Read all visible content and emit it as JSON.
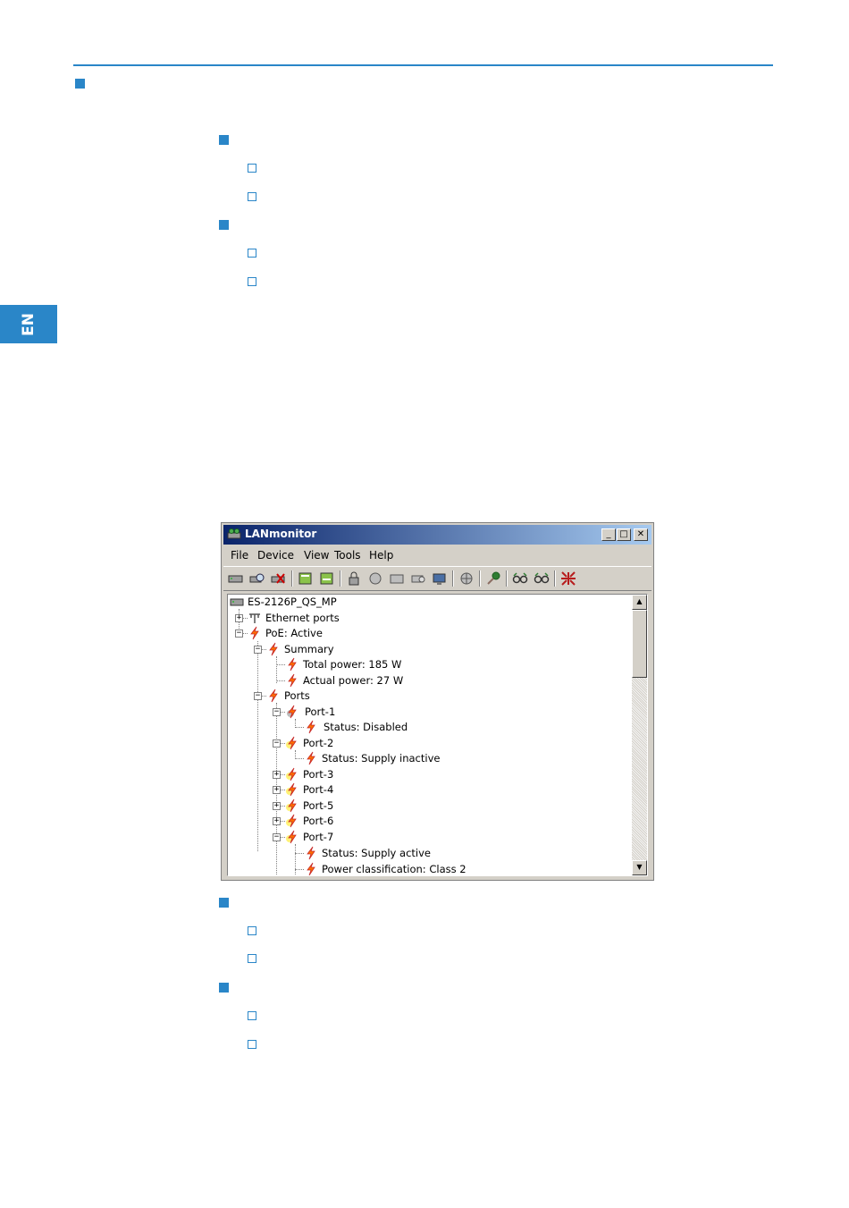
{
  "page": {
    "language_tab": "EN"
  },
  "window": {
    "title": "LANmonitor",
    "controls": {
      "minimize": "_",
      "maximize": "□",
      "close": "✕"
    },
    "menu": [
      "File",
      "Device",
      "View",
      "Tools",
      "Help"
    ],
    "toolbar_icons": [
      "device-icon",
      "search-device-icon",
      "delete-device-icon",
      "refresh-icon",
      "refresh-all-icon",
      "lock-icon",
      "hand-icon",
      "device-settings-icon",
      "trace-icon",
      "monitor-icon",
      "globe-icon",
      "key-icon",
      "glasses-icon",
      "glasses-all-icon",
      "collapse-icon"
    ]
  },
  "tree": {
    "root": "ES-2126P_QS_MP",
    "ethernet_ports": "Ethernet ports",
    "poe": "PoE: Active",
    "summary": "Summary",
    "total_power": "Total power: 185 W",
    "actual_power": "Actual power: 27 W",
    "ports": "Ports",
    "port1": "Port-1",
    "port1_status": "Status: Disabled",
    "port2": "Port-2",
    "port2_status": "Status: Supply inactive",
    "port3": "Port-3",
    "port4": "Port-4",
    "port5": "Port-5",
    "port6": "Port-6",
    "port7": "Port-7",
    "port7_status": "Status: Supply active",
    "port7_class": "Power classification: Class 2"
  }
}
